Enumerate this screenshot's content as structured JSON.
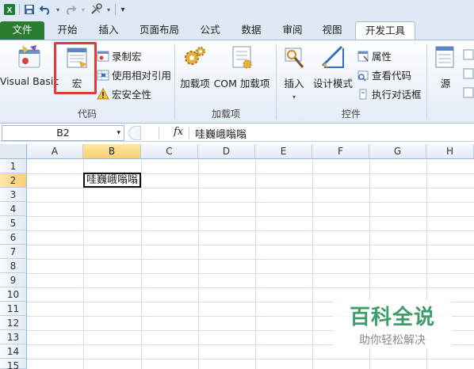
{
  "tabs": {
    "file": "文件",
    "items": [
      "开始",
      "插入",
      "页面布局",
      "公式",
      "数据",
      "审阅",
      "视图",
      "开发工具"
    ],
    "active_index": 7
  },
  "ribbon": {
    "code_group": {
      "label": "代码",
      "visual_basic": "Visual Basic",
      "macros": "宏",
      "record_macro": "录制宏",
      "relative_ref": "使用相对引用",
      "macro_security": "宏安全性"
    },
    "addins_group": {
      "label": "加载项",
      "addins": "加载项",
      "com_addins": "COM 加载项"
    },
    "controls_group": {
      "label": "控件",
      "insert": "插入",
      "design_mode": "设计模式",
      "properties": "属性",
      "view_code": "查看代码",
      "run_dialog": "执行对话框"
    },
    "xml_group": {
      "source": "源"
    }
  },
  "formula_bar": {
    "name_box": "B2",
    "fx": "fx",
    "content": "哇巍峨嗡嗡"
  },
  "sheet": {
    "columns": [
      "A",
      "B",
      "C",
      "D",
      "E",
      "F",
      "G",
      "H"
    ],
    "rows": [
      "1",
      "2",
      "3",
      "4",
      "5",
      "6",
      "7",
      "8",
      "9",
      "10",
      "11",
      "12",
      "13",
      "14",
      "15"
    ],
    "selected_cell": "B2",
    "b2_value": "哇巍峨嗡嗡"
  },
  "watermark": {
    "title": "百科全说",
    "subtitle": "助你轻松解决"
  },
  "colors": {
    "file_tab": "#2a7d2e",
    "highlight_box": "#e03a3a",
    "selected_header": "#f8cf6c",
    "watermark_green": "#3e9d6b"
  }
}
